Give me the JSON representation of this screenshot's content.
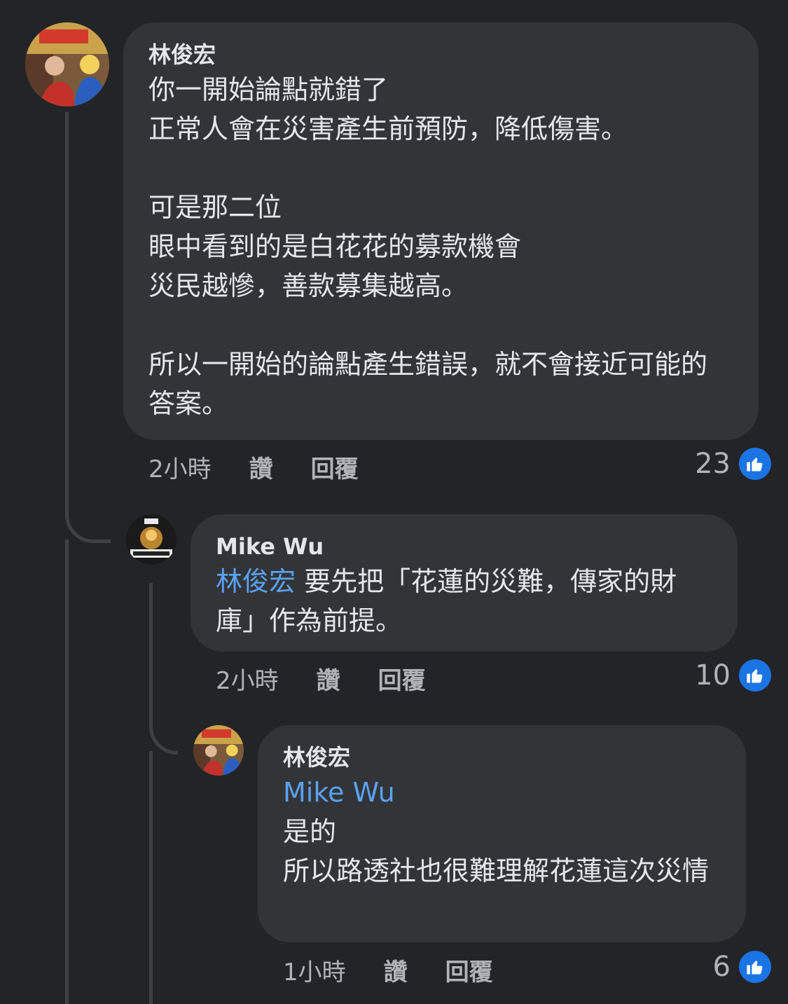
{
  "comments": [
    {
      "author": "林俊宏",
      "paragraphs": [
        [
          "你一開始論點就錯了",
          "正常人會在災害產生前預防，降低傷害。"
        ],
        [
          "可是那二位",
          "眼中看到的是白花花的募款機會",
          "災民越慘，善款募集越高。"
        ],
        [
          "所以一開始的論點產生錯誤，就不會接近可能的答案。"
        ]
      ],
      "time": "2小時",
      "like_label": "讚",
      "reply_label": "回覆",
      "reactions": "23"
    },
    {
      "author": "Mike Wu",
      "mention": "林俊宏",
      "text": " 要先把「花蓮的災難，傳家的財庫」作為前提。",
      "time": "2小時",
      "like_label": "讚",
      "reply_label": "回覆",
      "reactions": "10"
    },
    {
      "author": "林俊宏",
      "mention": "Mike Wu",
      "lines": [
        "是的",
        "所以路透社也很難理解花蓮這次災情"
      ],
      "time": "1小時",
      "like_label": "讚",
      "reply_label": "回覆",
      "reactions": "6"
    }
  ],
  "colors": {
    "background": "#232427",
    "bubble": "#333437",
    "mention": "#5aa2f6",
    "like_badge": "#1b74e4",
    "meta_text": "#b0b3b8"
  },
  "icons": {
    "reaction": "thumbs-up-icon"
  }
}
